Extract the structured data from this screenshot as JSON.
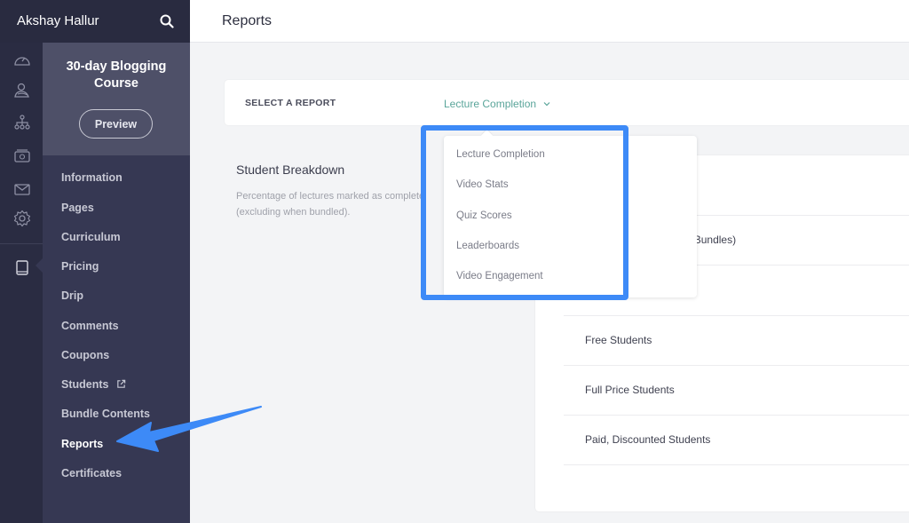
{
  "topbar": {
    "user_name": "Akshay Hallur",
    "search_icon": "search-icon"
  },
  "icon_rail": {
    "items": [
      {
        "name": "dashboard-gauge-icon"
      },
      {
        "name": "users-icon"
      },
      {
        "name": "sitemap-icon"
      },
      {
        "name": "sales-money-icon"
      },
      {
        "name": "mail-icon"
      },
      {
        "name": "settings-gear-icon"
      },
      {
        "name": "courses-book-icon",
        "active": true
      }
    ]
  },
  "course": {
    "title": "30-day Blogging Course",
    "preview_label": "Preview"
  },
  "nav": {
    "items": [
      {
        "label": "Information"
      },
      {
        "label": "Pages"
      },
      {
        "label": "Curriculum"
      },
      {
        "label": "Pricing"
      },
      {
        "label": "Drip"
      },
      {
        "label": "Comments"
      },
      {
        "label": "Coupons"
      },
      {
        "label": "Students",
        "external_icon": "external-link-icon"
      },
      {
        "label": "Bundle Contents"
      },
      {
        "label": "Reports",
        "active": true
      },
      {
        "label": "Certificates"
      }
    ]
  },
  "header": {
    "title": "Reports"
  },
  "report_selector": {
    "label": "SELECT A REPORT",
    "selected": "Lecture Completion",
    "options": [
      "Lecture Completion",
      "Video Stats",
      "Quiz Scores",
      "Leaderboards",
      "Video Engagement"
    ]
  },
  "student_breakdown": {
    "title": "Student Breakdown",
    "description": "Percentage of lectures marked as complete (excluding when bundled).",
    "rows": [
      {
        "label": ""
      },
      {
        "label": "All Students (Including Bundles)",
        "visible_fragment": "ng Bundles)"
      },
      {
        "label": ""
      },
      {
        "label": "Free Students"
      },
      {
        "label": "Full Price Students"
      },
      {
        "label": "Paid, Discounted Students"
      }
    ]
  },
  "annotations": {
    "highlight_color": "#3d8af7",
    "arrow_color": "#3d8af7"
  },
  "colors": {
    "accent_teal": "#5aa59a",
    "sidebar_dark": "#292b40",
    "sidebar_nav": "#363853",
    "course_panel": "#4e5068"
  }
}
